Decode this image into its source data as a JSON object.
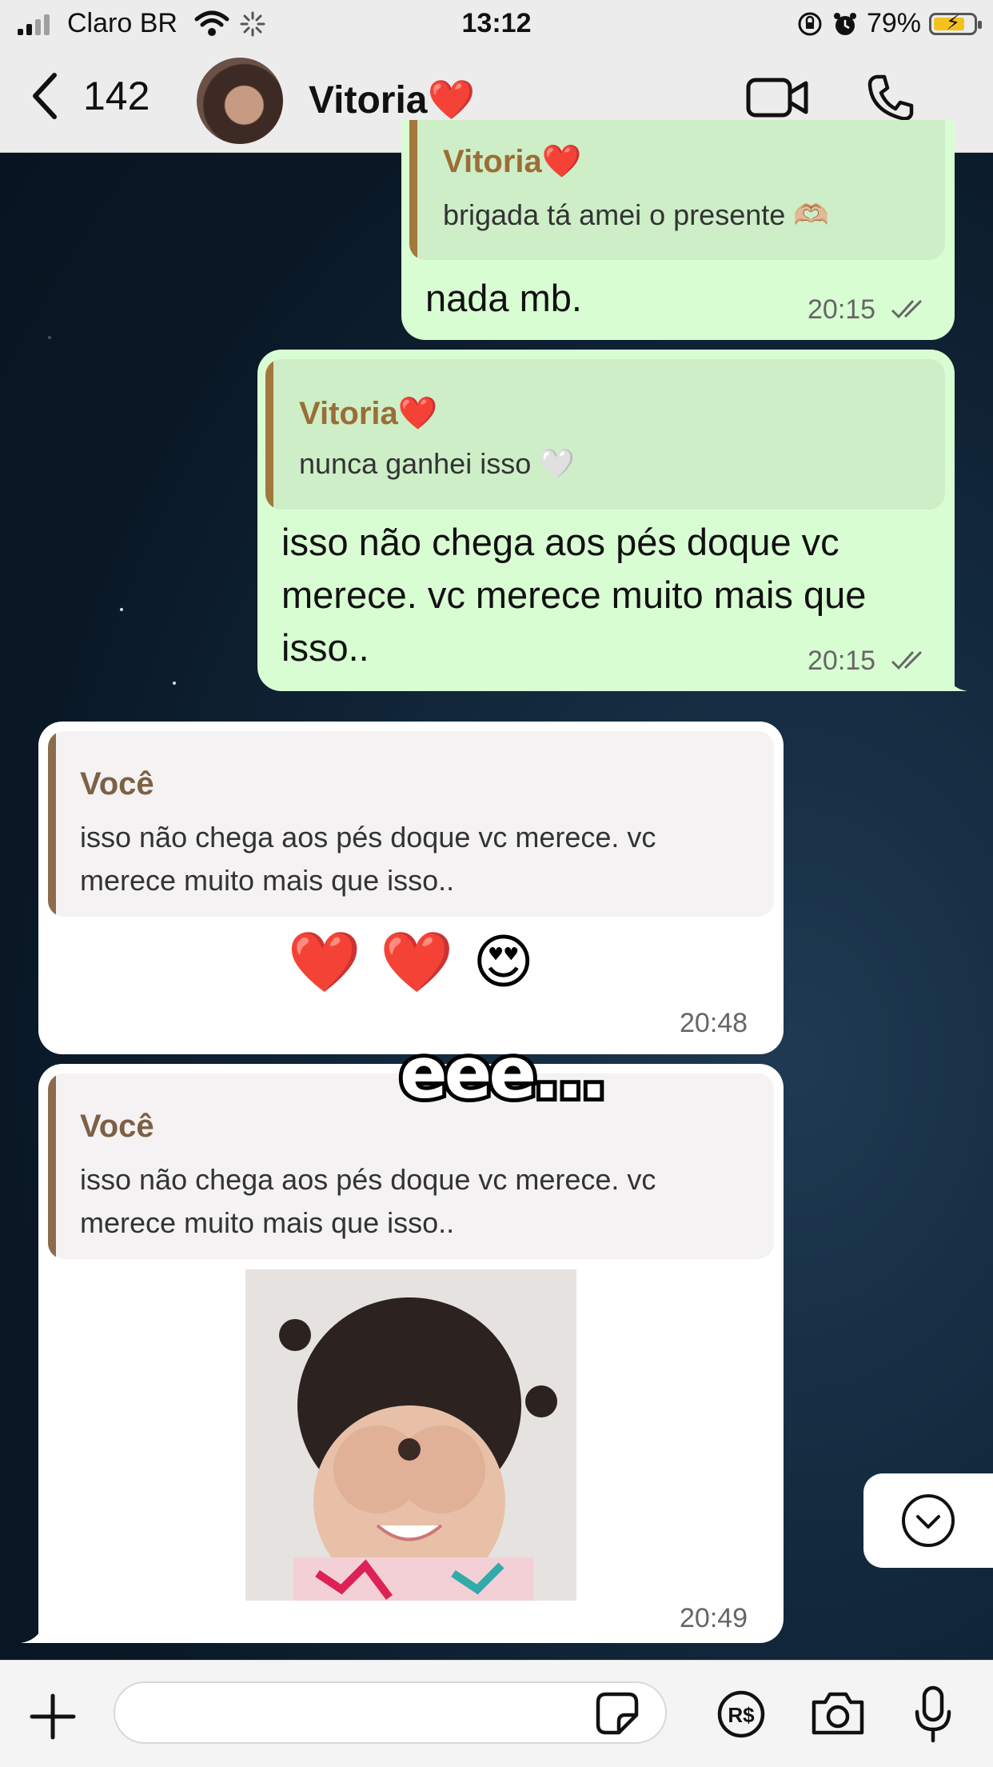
{
  "status_bar": {
    "carrier": "Claro BR",
    "time": "13:12",
    "battery": "79%",
    "battery_level": 0.79
  },
  "header": {
    "back_count": "142",
    "contact_name": "Vitoria❤️"
  },
  "messages": [
    {
      "direction": "outgoing",
      "quote_author": "Vitoria❤️",
      "quote_text": "brigada tá amei o presente 🫶🏼",
      "text": "nada mb.",
      "time": "20:15"
    },
    {
      "direction": "outgoing",
      "quote_author": "Vitoria❤️",
      "quote_text": "nunca ganhei isso 🤍",
      "text_lines": [
        "isso não chega aos pés doque vc",
        "merece. vc merece muito mais que",
        "isso.."
      ],
      "time": "20:15"
    },
    {
      "direction": "incoming",
      "quote_author": "Você",
      "quote_text_lines": [
        "isso não chega aos pés doque vc merece. vc",
        "merece muito mais que isso.."
      ],
      "text": "❤️ ❤️ 😍",
      "time": "20:48"
    },
    {
      "direction": "incoming",
      "quote_author": "Você",
      "quote_text_lines": [
        "isso não chega aos pés doque vc merece. vc",
        "merece muito mais que isso.."
      ],
      "media": "photo-sticker",
      "time": "20:49"
    }
  ],
  "overlay_text": "eee...",
  "input": {
    "placeholder": ""
  },
  "icons": [
    "chevron-left-icon",
    "video-camera-icon",
    "phone-icon",
    "plus-icon",
    "sticker-icon",
    "payment-icon",
    "camera-icon",
    "microphone-icon",
    "chevron-down-icon"
  ],
  "colors": {
    "outgoing_bubble": "#d9fdd3",
    "incoming_bubble": "#ffffff",
    "header_bg": "#ececec"
  }
}
